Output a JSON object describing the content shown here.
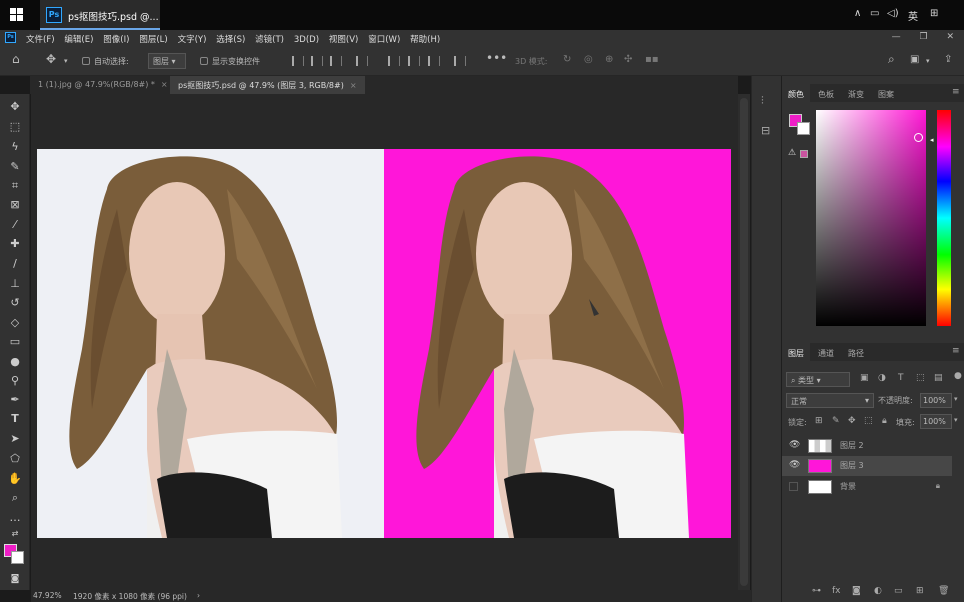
{
  "taskbar": {
    "app_title": "ps抠图技巧.psd @...",
    "tray_lang": "英"
  },
  "menubar": {
    "items": [
      "文件(F)",
      "编辑(E)",
      "图像(I)",
      "图层(L)",
      "文字(Y)",
      "选择(S)",
      "滤镜(T)",
      "3D(D)",
      "视图(V)",
      "窗口(W)",
      "帮助(H)"
    ]
  },
  "options": {
    "auto_select_label": "自动选择:",
    "auto_select_value": "图层",
    "show_transform_label": "显示变换控件",
    "mode_3d_label": "3D 模式:"
  },
  "tabs": [
    {
      "label": "1 (1).jpg @ 47.9%(RGB/8#) *",
      "close": "×"
    },
    {
      "label": "ps抠图技巧.psd @ 47.9% (图层 3, RGB/8#)",
      "close": "×"
    }
  ],
  "status": {
    "zoom": "47.92%",
    "doc_info": "1920 像素 x 1080 像素 (96 ppi)",
    "arrow": "›"
  },
  "color_panel": {
    "tabs": [
      "颜色",
      "色板",
      "渐变",
      "图案"
    ],
    "active_tab": 0,
    "fg_color": "#ef1ec7",
    "bg_color": "#ffffff"
  },
  "layers_panel": {
    "tabs": [
      "图层",
      "通道",
      "路径"
    ],
    "filter_label": "类型",
    "blend_mode": "正常",
    "opacity_label": "不透明度:",
    "opacity_value": "100%",
    "lock_label": "锁定:",
    "fill_label": "填充:",
    "fill_value": "100%",
    "layers": [
      {
        "name": "图层 2",
        "visible": true,
        "selected": false
      },
      {
        "name": "图层 3",
        "visible": true,
        "selected": true
      },
      {
        "name": "背景",
        "visible": false,
        "selected": false,
        "locked": true
      }
    ]
  },
  "colors": {
    "magenta": "#ff16d9",
    "light_bg": "#eef0f5",
    "ui_dark": "#323232"
  }
}
